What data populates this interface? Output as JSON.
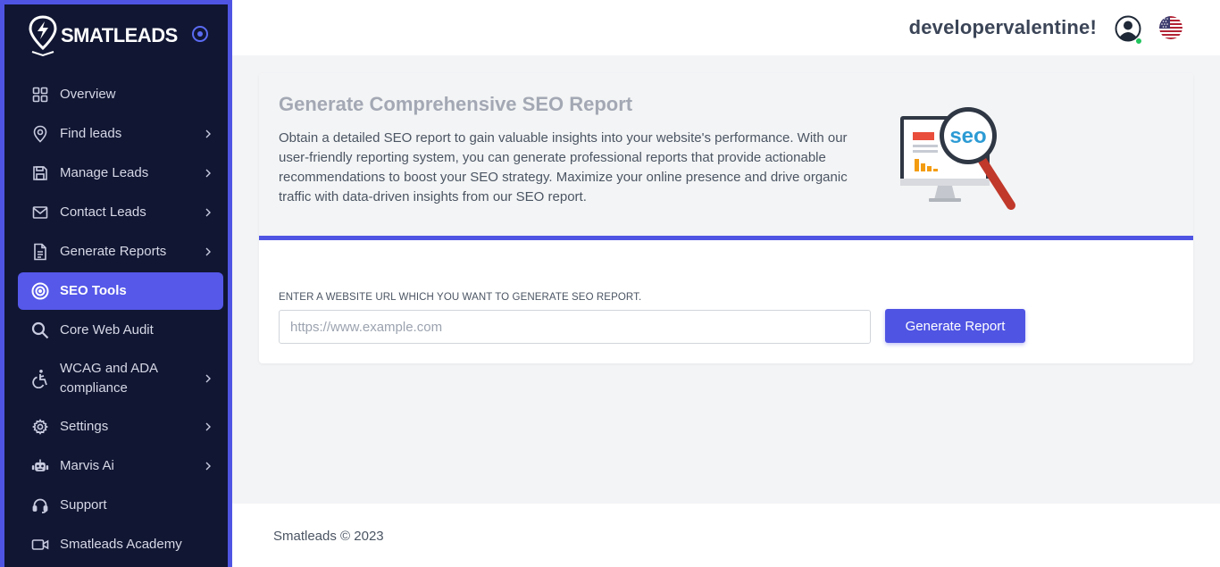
{
  "brand": {
    "name": "SMATLEADS",
    "logo_icon": "map-pin-bolt-logo",
    "toggle_icon": "target-toggle-icon"
  },
  "colors": {
    "accent": "#4f54e3",
    "sidebar_bg": "#111633",
    "active_item": "#5558e8",
    "online": "#22c55e"
  },
  "sidebar": {
    "items": [
      {
        "label": "Overview",
        "icon": "grid-icon",
        "has_submenu": false
      },
      {
        "label": "Find leads",
        "icon": "map-pin-icon",
        "has_submenu": true
      },
      {
        "label": "Manage Leads",
        "icon": "save-icon",
        "has_submenu": true
      },
      {
        "label": "Contact Leads",
        "icon": "mail-icon",
        "has_submenu": true
      },
      {
        "label": "Generate Reports",
        "icon": "document-icon",
        "has_submenu": true
      },
      {
        "label": "SEO Tools",
        "icon": "target-icon",
        "has_submenu": false,
        "active": true
      },
      {
        "label": "Core Web Audit",
        "icon": "search-icon",
        "has_submenu": false
      },
      {
        "label": "WCAG and ADA compliance",
        "icon": "accessibility-icon",
        "has_submenu": true
      },
      {
        "label": "Settings",
        "icon": "gear-icon",
        "has_submenu": true
      },
      {
        "label": "Marvis Ai",
        "icon": "robot-icon",
        "has_submenu": true
      },
      {
        "label": "Support",
        "icon": "headset-icon",
        "has_submenu": false
      },
      {
        "label": "Smatleads Academy",
        "icon": "video-icon",
        "has_submenu": false
      }
    ]
  },
  "header": {
    "username": "developervalentine!",
    "avatar_icon": "user-avatar-icon",
    "language_flag": "us-flag-icon"
  },
  "main": {
    "title": "Generate Comprehensive SEO Report",
    "description": "Obtain a detailed SEO report to gain valuable insights into your website's performance. With our user-friendly reporting system, you can generate professional reports that provide actionable recommendations to boost your SEO strategy. Maximize your online presence and drive organic traffic with data-driven insights from our SEO report.",
    "illustration": "seo-magnifier-illustration",
    "illustration_text": "seo",
    "url_label": "ENTER A WEBSITE URL WHICH YOU WANT TO GENERATE SEO REPORT.",
    "url_placeholder": "https://www.example.com",
    "url_value": "",
    "submit_label": "Generate Report"
  },
  "footer": {
    "text": "Smatleads © 2023"
  }
}
